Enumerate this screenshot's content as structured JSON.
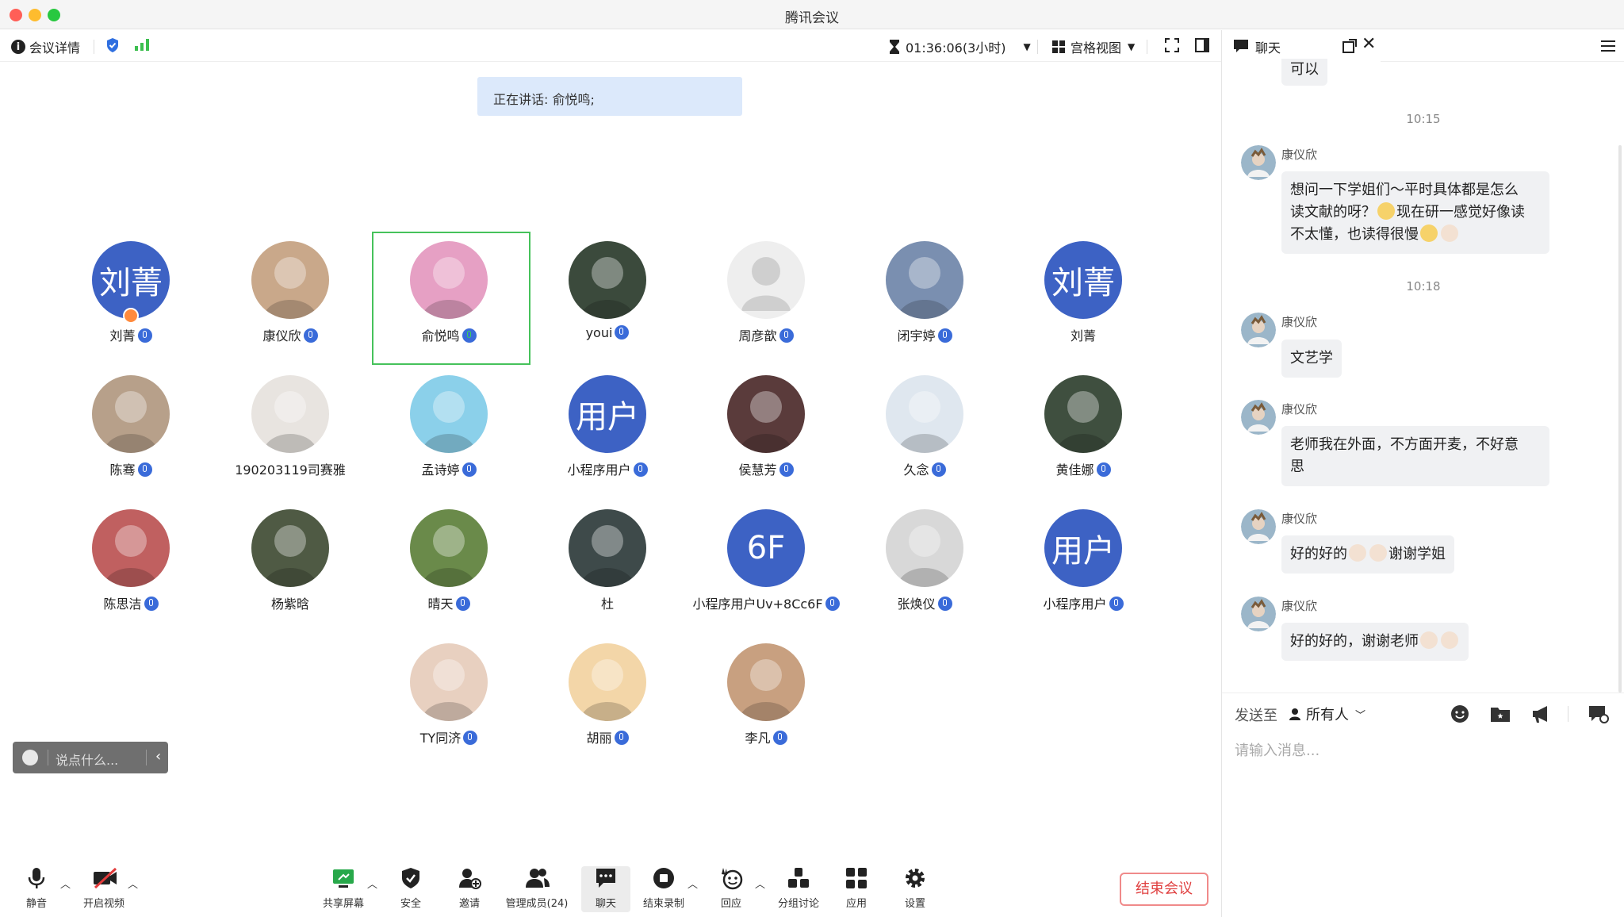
{
  "window": {
    "title": "腾讯会议"
  },
  "topbar": {
    "meeting_details": "会议详情",
    "timer": "01:36:06(3小时)",
    "view_mode": "宫格视图"
  },
  "speaking": {
    "text": "正在讲话: 俞悦鸣;"
  },
  "participants": [
    {
      "name": "刘菁",
      "initials": "刘菁",
      "mic": true,
      "host": true
    },
    {
      "name": "康仪欣",
      "mic": true
    },
    {
      "name": "俞悦鸣",
      "mic": true,
      "speaking": true
    },
    {
      "name": "youi",
      "mic": true
    },
    {
      "name": "周彦歆",
      "mic": true
    },
    {
      "name": "闭宇婷",
      "mic": true
    },
    {
      "name": "刘菁",
      "initials": "刘菁",
      "mic": false
    },
    {
      "name": "陈骞",
      "mic": true
    },
    {
      "name": "190203119司赛雅",
      "mic": false
    },
    {
      "name": "孟诗婷",
      "mic": true
    },
    {
      "name": "小程序用户",
      "initials": "用户",
      "mic": true
    },
    {
      "name": "侯慧芳",
      "mic": true
    },
    {
      "name": "久念",
      "mic": true
    },
    {
      "name": "黄佳娜",
      "mic": true
    },
    {
      "name": "陈思洁",
      "mic": true
    },
    {
      "name": "杨紫晗",
      "mic": false
    },
    {
      "name": "晴天",
      "mic": true
    },
    {
      "name": "杜",
      "mic": false
    },
    {
      "name": "小程序用户Uv+8Cc6F",
      "initials": "6F",
      "mic": true
    },
    {
      "name": "张焕仪",
      "mic": true
    },
    {
      "name": "小程序用户",
      "initials": "用户",
      "mic": true
    },
    {
      "name": "TY同济",
      "mic": true
    },
    {
      "name": "胡丽",
      "mic": true
    },
    {
      "name": "李凡",
      "mic": true
    }
  ],
  "saybox": {
    "placeholder": "说点什么..."
  },
  "bottombar": {
    "mute": "静音",
    "video": "开启视频",
    "share": "共享屏幕",
    "security": "安全",
    "invite": "邀请",
    "members": "管理成员(24)",
    "chat": "聊天",
    "record": "结束录制",
    "react": "回应",
    "breakout": "分组讨论",
    "apps": "应用",
    "settings": "设置",
    "end": "结束会议"
  },
  "chat": {
    "title": "聊天",
    "first_bubble": "可以",
    "time1": "10:15",
    "time2": "10:18",
    "messages": [
      {
        "sender": "康仪欣",
        "line1": "想问一下学姐们～平时具体都是怎么",
        "line2a": "读文献的呀？",
        "line2b": "现在研一感觉好像读",
        "line3": "不太懂，也读得很慢"
      },
      {
        "sender": "康仪欣",
        "text": "文艺学"
      },
      {
        "sender": "康仪欣",
        "line1": "老师我在外面，不方面开麦，不好意",
        "line2": "思"
      },
      {
        "sender": "康仪欣",
        "text_a": "好的好的",
        "text_b": "谢谢学姐"
      },
      {
        "sender": "康仪欣",
        "text_a": "好的好的，谢谢老师"
      }
    ],
    "send_to_label": "发送至",
    "send_to_value": "所有人",
    "input_placeholder": "请输入消息..."
  }
}
